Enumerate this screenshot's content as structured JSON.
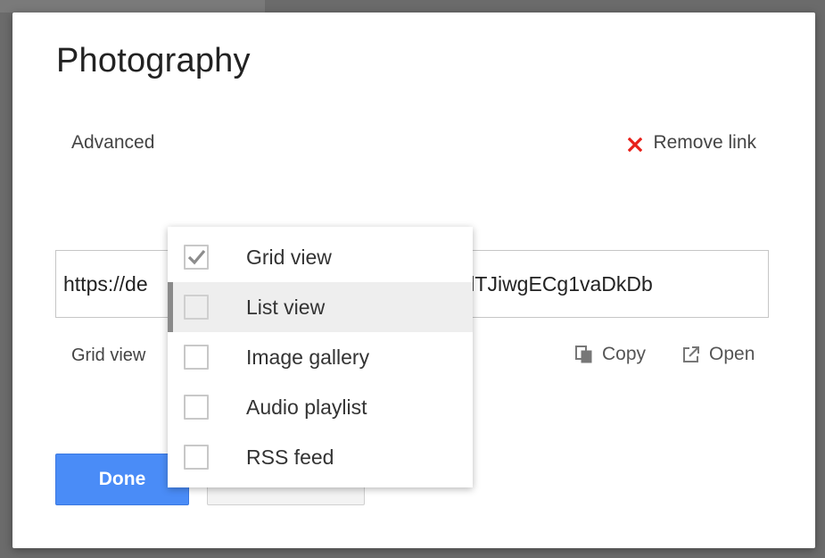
{
  "dialog": {
    "title": "Photography",
    "advanced_label": "Advanced",
    "remove_link_label": "Remove link",
    "url_value": "https://de                                            MgfOxblTJiwgECg1vaDkDb",
    "view_selector_label": "Grid view",
    "copy_label": "Copy",
    "open_label": "Open",
    "done_label": "Done",
    "cancel_label": ""
  },
  "view_menu": {
    "items": [
      {
        "label": "Grid view",
        "checked": true,
        "hovered": false
      },
      {
        "label": "List view",
        "checked": false,
        "hovered": true
      },
      {
        "label": "Image gallery",
        "checked": false,
        "hovered": false
      },
      {
        "label": "Audio playlist",
        "checked": false,
        "hovered": false
      },
      {
        "label": "RSS feed",
        "checked": false,
        "hovered": false
      }
    ]
  },
  "colors": {
    "remove_icon": "#e8201a",
    "done_button": "#4a8cf7",
    "checkmark": "#8c8c8c"
  },
  "icons": {
    "remove": "close-icon",
    "copy": "copy-icon",
    "open": "external-link-icon",
    "check": "checkmark-icon"
  }
}
